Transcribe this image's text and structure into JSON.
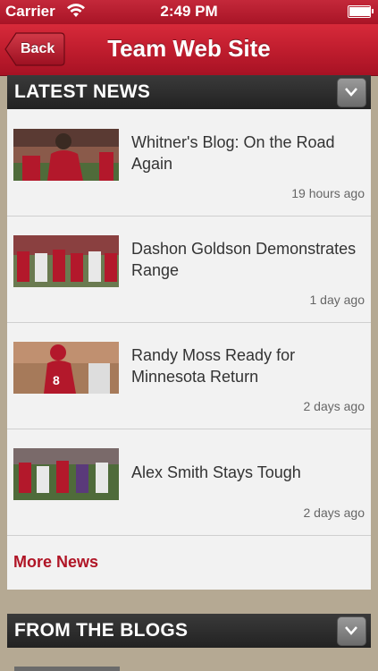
{
  "status_bar": {
    "carrier": "Carrier",
    "time": "2:49 PM",
    "battery_level": 0.95
  },
  "nav": {
    "back_label": "Back",
    "title": "Team Web Site"
  },
  "sections": {
    "latest_news": {
      "title": "LATEST NEWS",
      "toggle_icon": "chevron-down-icon",
      "items": [
        {
          "headline": "Whitner's Blog: On the Road Again",
          "time": "19 hours ago"
        },
        {
          "headline": "Dashon Goldson Demonstrates Range",
          "time": "1 day ago"
        },
        {
          "headline": "Randy Moss Ready for Minnesota Return",
          "time": "2 days ago"
        },
        {
          "headline": "Alex Smith Stays Tough",
          "time": "2 days ago"
        }
      ],
      "more_label": "More News"
    },
    "from_the_blogs": {
      "title": "FROM THE BLOGS",
      "toggle_icon": "chevron-down-icon"
    }
  },
  "colors": {
    "brand_red": "#c01d2e",
    "header_dark": "#2b2b2b",
    "link_red": "#b01526",
    "background": "#b5a993"
  }
}
